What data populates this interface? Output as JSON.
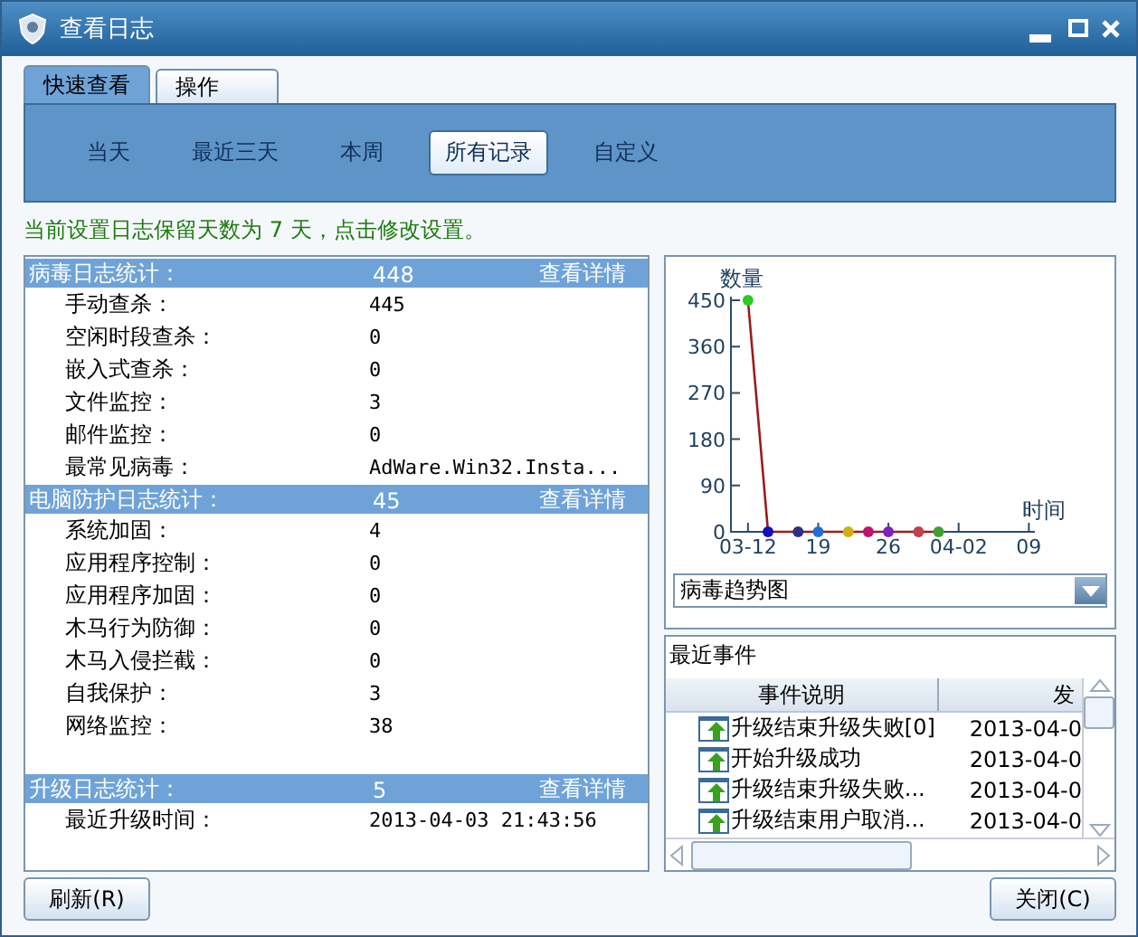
{
  "window": {
    "title": "查看日志"
  },
  "tabs": [
    {
      "label": "快速查看",
      "selected": true
    },
    {
      "label": "操作",
      "selected": false
    }
  ],
  "ranges": [
    {
      "label": "当天",
      "selected": false
    },
    {
      "label": "最近三天",
      "selected": false
    },
    {
      "label": "本周",
      "selected": false
    },
    {
      "label": "所有记录",
      "selected": true
    },
    {
      "label": "自定义",
      "selected": false
    }
  ],
  "notice": "当前设置日志保留天数为 7 天，点击修改设置。",
  "sections": [
    {
      "title": "病毒日志统计：",
      "total": "448",
      "link": "查看详情",
      "rows": [
        {
          "label": "手动查杀：",
          "value": "445"
        },
        {
          "label": "空闲时段查杀：",
          "value": "0"
        },
        {
          "label": "嵌入式查杀：",
          "value": "0"
        },
        {
          "label": "文件监控：",
          "value": "3"
        },
        {
          "label": "邮件监控：",
          "value": "0"
        },
        {
          "label": "最常见病毒：",
          "value": "AdWare.Win32.Insta..."
        }
      ]
    },
    {
      "title": "电脑防护日志统计：",
      "total": "45",
      "link": "查看详情",
      "rows": [
        {
          "label": "系统加固：",
          "value": "4"
        },
        {
          "label": "应用程序控制：",
          "value": "0"
        },
        {
          "label": "应用程序加固：",
          "value": "0"
        },
        {
          "label": "木马行为防御：",
          "value": "0"
        },
        {
          "label": "木马入侵拦截：",
          "value": "0"
        },
        {
          "label": "自我保护：",
          "value": "3"
        },
        {
          "label": "网络监控：",
          "value": "38"
        }
      ]
    },
    {
      "title": "升级日志统计：",
      "total": "5",
      "link": "查看详情",
      "rows": [
        {
          "label": "最近升级时间：",
          "value": "2013-04-03 21:43:56"
        }
      ]
    }
  ],
  "trend": {
    "chart_data": {
      "type": "line",
      "ylabel": "数量",
      "xlabel": "时间",
      "categories": [
        "03-12",
        null,
        null,
        null,
        null,
        null,
        null,
        "19",
        null,
        null,
        null,
        null,
        null,
        null,
        "26",
        null,
        null,
        null,
        null,
        null,
        null,
        "04-02",
        null,
        null,
        null,
        null,
        null,
        null,
        "09"
      ],
      "ylim": [
        0,
        450
      ],
      "yticks": [
        0,
        90,
        180,
        270,
        360,
        450
      ],
      "series": [
        {
          "color": "#9b1c1c",
          "marker": "circle",
          "values": [
            450,
            null,
            0,
            null,
            null,
            0,
            null,
            0,
            null,
            null,
            0,
            null,
            0,
            null,
            0,
            null,
            null,
            0,
            null,
            0,
            null,
            null,
            null,
            null,
            null,
            null,
            null,
            null,
            null
          ]
        }
      ]
    },
    "selector": {
      "value": "病毒趋势图"
    }
  },
  "events": {
    "title": "最近事件",
    "columns": [
      "事件说明",
      "发"
    ],
    "rows": [
      {
        "text": "升级结束升级失败[0]",
        "date": "2013-04-0"
      },
      {
        "text": "开始升级成功",
        "date": "2013-04-0"
      },
      {
        "text": "升级结束升级失败...",
        "date": "2013-04-0"
      },
      {
        "text": "升级结束用户取消...",
        "date": "2013-04-0"
      }
    ]
  },
  "buttons": [
    {
      "label": "刷新(R)"
    },
    {
      "label": "关闭(C)"
    }
  ]
}
